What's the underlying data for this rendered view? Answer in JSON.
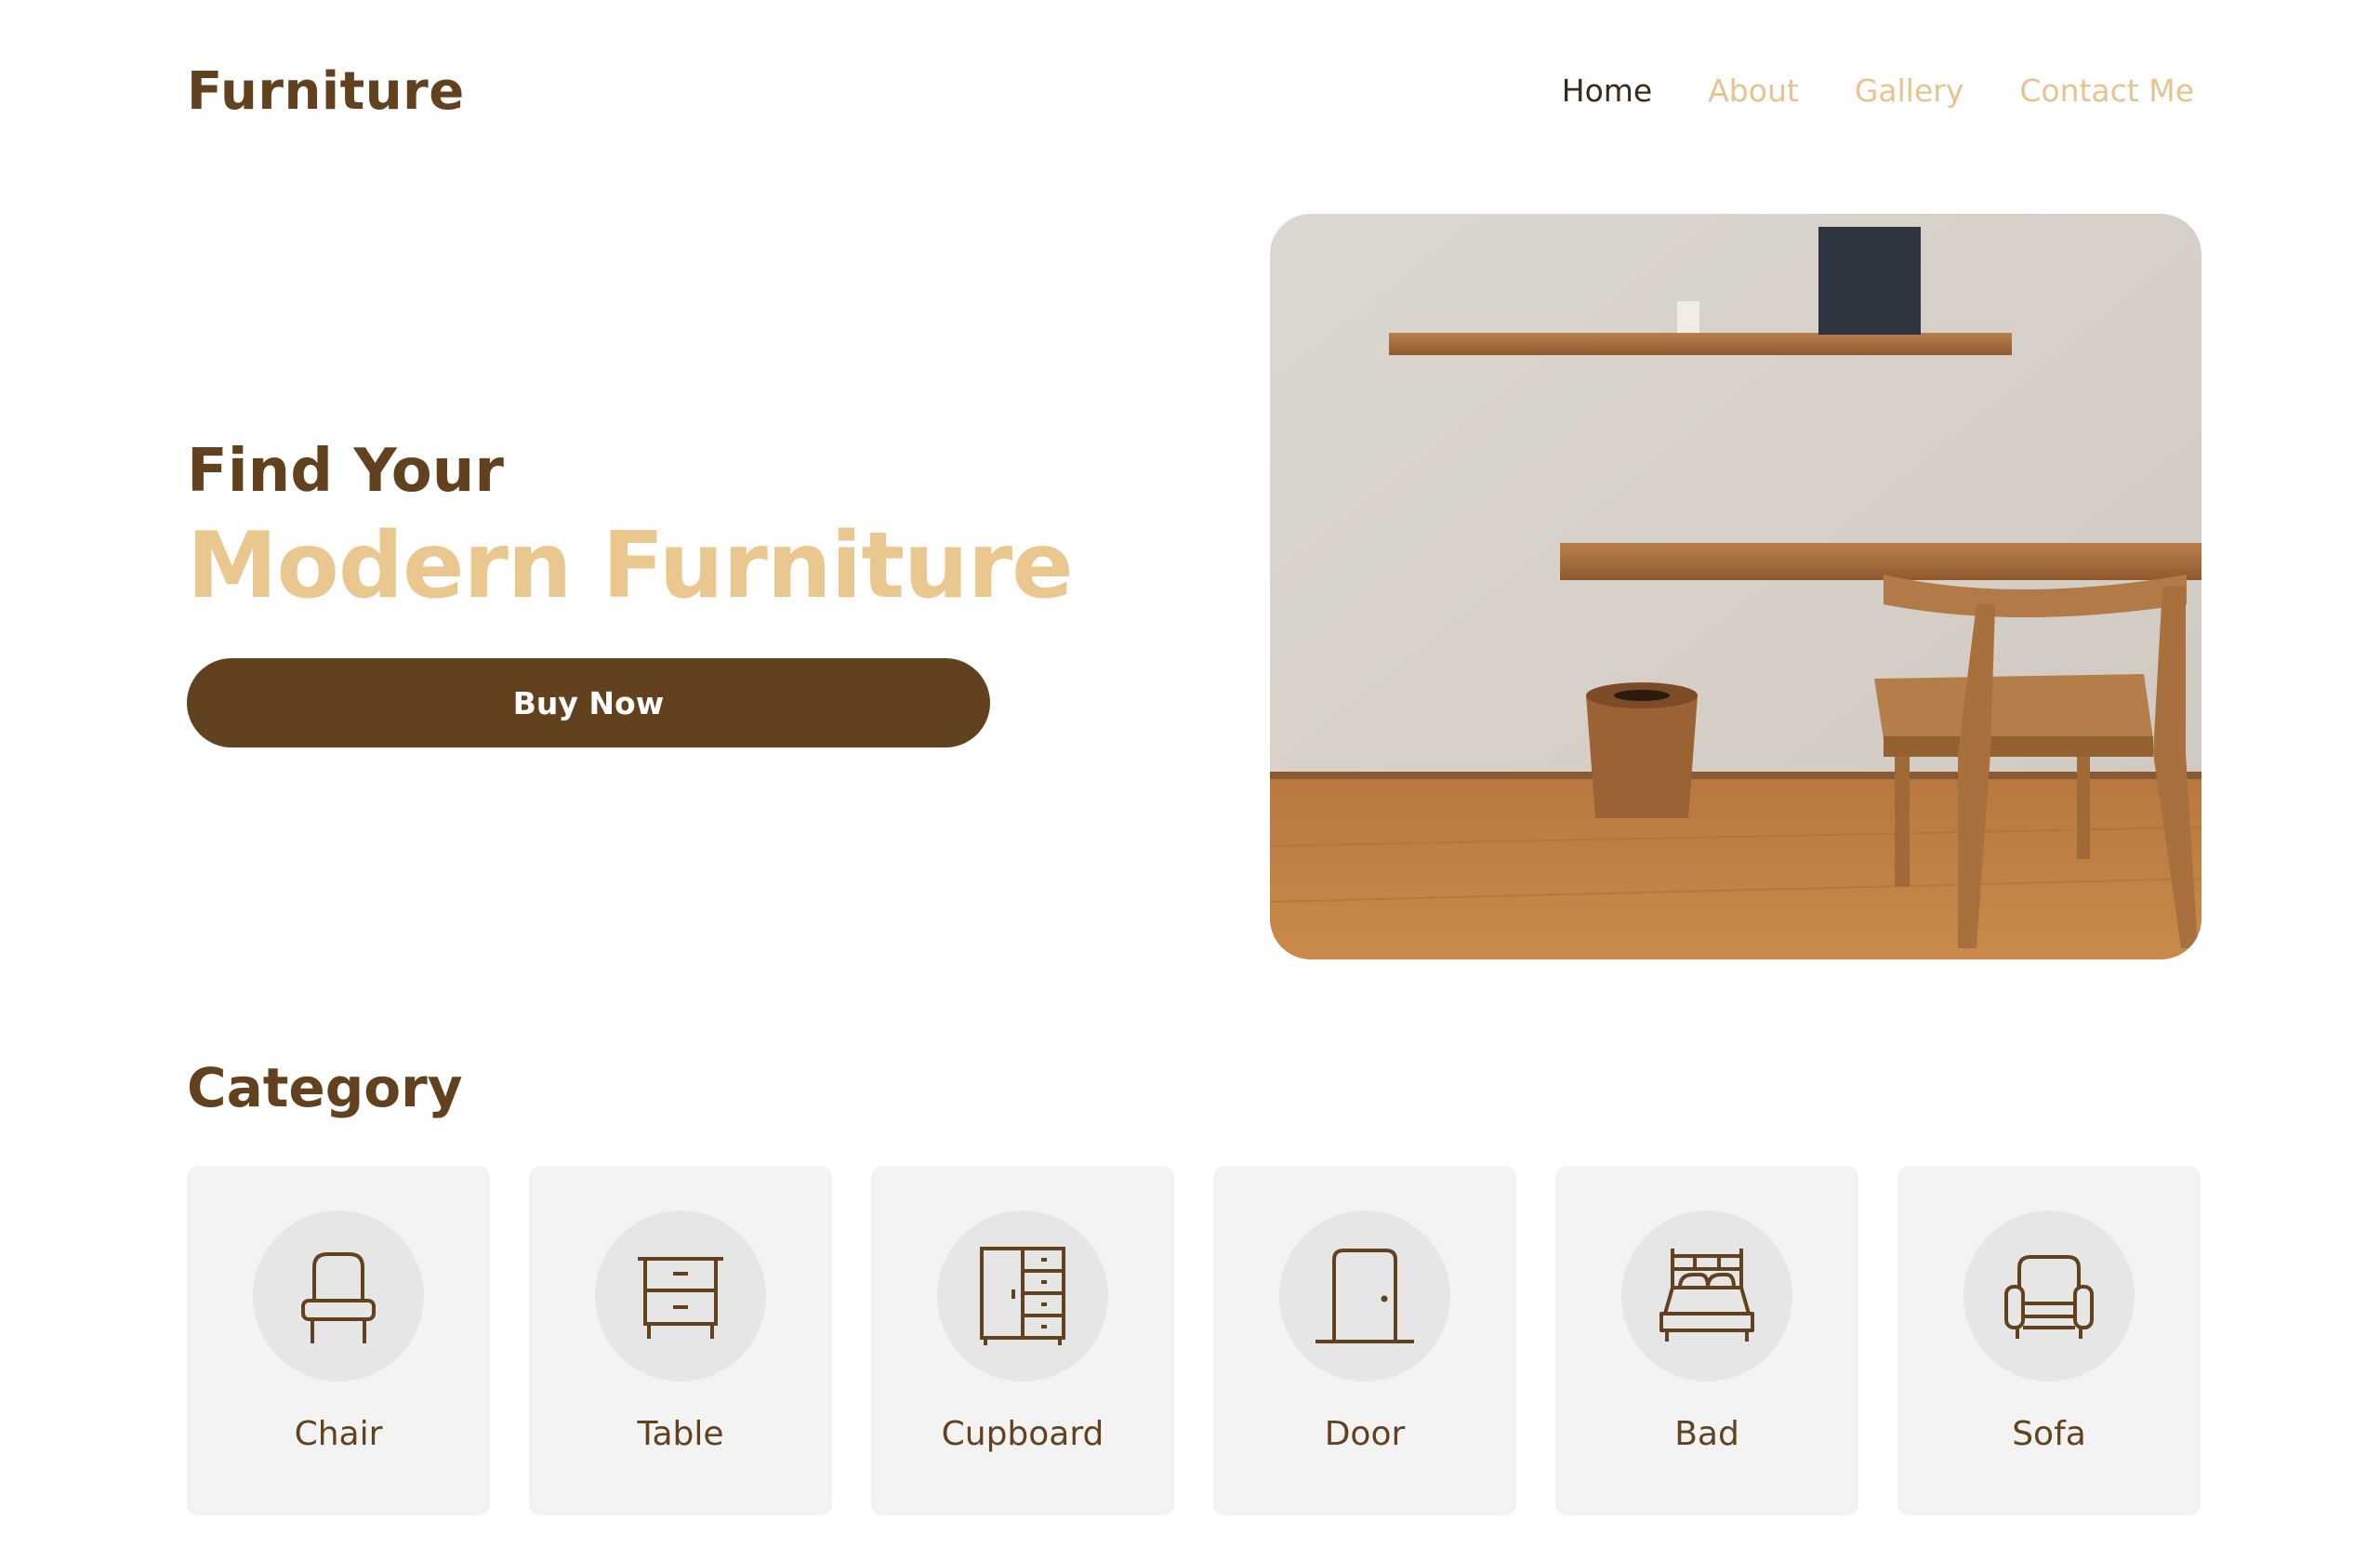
{
  "header": {
    "logo": "Furniture",
    "nav": [
      "Home",
      "About",
      "Gallery",
      "Contact Me"
    ],
    "active_nav": "Home"
  },
  "hero": {
    "subtitle": "Find Your",
    "title": "Modern Furniture",
    "button": "Buy Now"
  },
  "category": {
    "heading": "Category",
    "items": [
      {
        "label": "Chair",
        "icon": "chair-icon"
      },
      {
        "label": "Table",
        "icon": "table-icon"
      },
      {
        "label": "Cupboard",
        "icon": "cupboard-icon"
      },
      {
        "label": "Door",
        "icon": "door-icon"
      },
      {
        "label": "Bad",
        "icon": "bed-icon"
      },
      {
        "label": "Sofa",
        "icon": "sofa-icon"
      }
    ]
  },
  "colors": {
    "brand_dark": "#62421e",
    "brand_light": "#ebc790",
    "card_bg": "#f3f3f3"
  }
}
